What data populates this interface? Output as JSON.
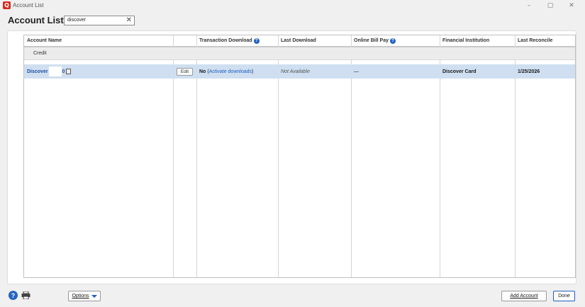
{
  "window": {
    "icon_letter": "Q",
    "title": "Account List",
    "controls": {
      "minimize": "–",
      "restore": "▢",
      "close": "✕"
    }
  },
  "header": {
    "title": "Account List",
    "search": {
      "value": "discover",
      "clear": "✕"
    }
  },
  "table": {
    "columns": [
      {
        "label": "Account Name"
      },
      {
        "label": ""
      },
      {
        "label": "Transaction Download",
        "help": true
      },
      {
        "label": "Last Download"
      },
      {
        "label": "Online Bill Pay",
        "help": true
      },
      {
        "label": "Financial Institution"
      },
      {
        "label": "Last Reconcile"
      }
    ],
    "group": "Credit",
    "rows": [
      {
        "account_name": "Discover",
        "account_suffix": "0",
        "edit_label": "Edit",
        "download_status": "No",
        "download_link": "Activate downloads",
        "last_download": "Not Available",
        "bill_pay": "—",
        "institution": "Discover Card",
        "last_reconcile": "1/25/2026"
      }
    ]
  },
  "footer": {
    "help_glyph": "?",
    "options_label": "Options",
    "add_account_label": "Add Account",
    "done_label": "Done"
  },
  "colors": {
    "selected_row": "#cfdff1",
    "link": "#1f5cc4",
    "brand": "#d52b1e"
  }
}
